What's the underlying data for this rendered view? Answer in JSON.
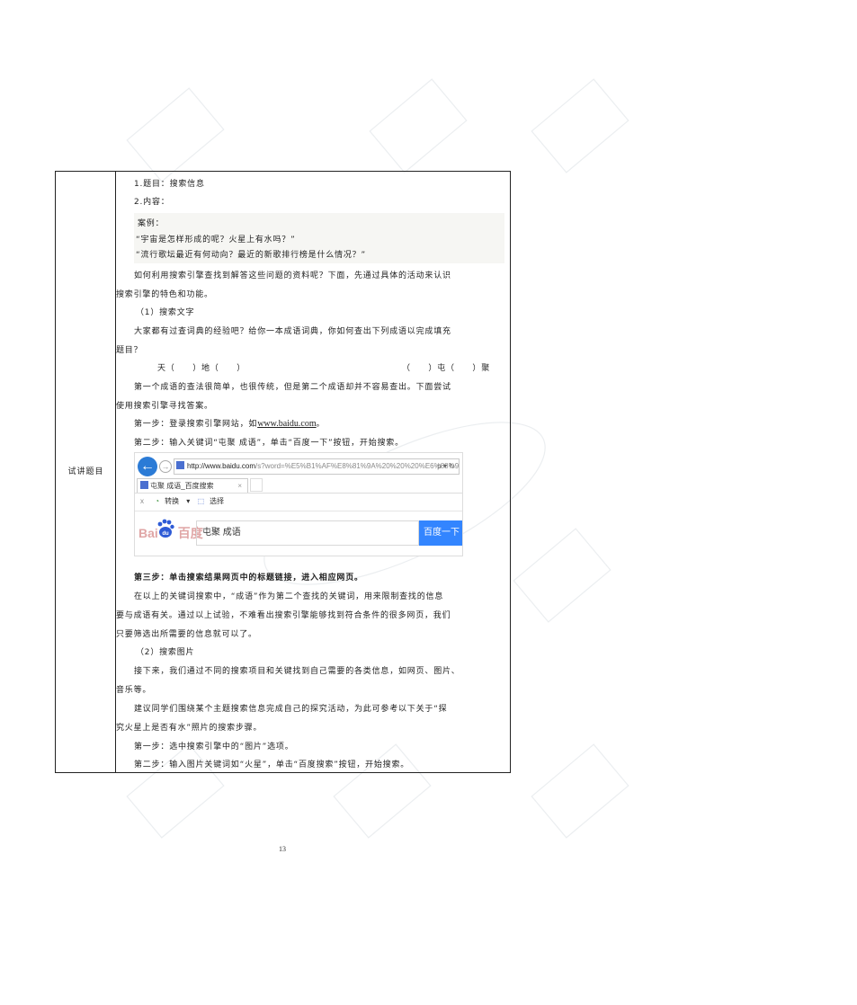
{
  "table": {
    "left_label": "试讲题目",
    "item1": "1.题目：搜索信息",
    "item2": "2.内容：",
    "case": {
      "title": "案例：",
      "q1": "“宇宙是怎样形成的呢？火星上有水吗？”",
      "q2": "“流行歌坛最近有何动向？最近的新歌排行榜是什么情况？”"
    },
    "para1_l1": "如何利用搜索引擎查找到解答这些问题的资料呢？下面，先通过具体的活动来认识",
    "para1_l2": "搜索引擎的特色和功能。",
    "section1": "（1）搜索文字",
    "para2_l1": "大家都有过查词典的经验吧？给你一本成语词典，你如何查出下列成语以完成填充",
    "para2_l2": "题目？",
    "fill_left": "天（　　）地（　　）",
    "fill_right": "（　　）屯（　　）聚",
    "para3_l1": "第一个成语的查法很简单，也很传统，但是第二个成语却并不容易查出。下面尝试",
    "para3_l2": "使用搜索引擎寻找答案。",
    "step1_prefix": "第一步：登录搜索引擎网站，如",
    "step1_link": "www.baidu.com",
    "step1_suffix": "。",
    "step2": "第二步：输入关键词“屯聚 成语”，单击“百度一下”按钮，开始搜索。",
    "step3": "第三步：单击搜索结果网页中的标题链接，进入相应网页。",
    "para4_l1": "在以上的关键词搜索中，“成语”作为第二个查找的关键词，用来限制查找的信息",
    "para4_l2": "要与成语有关。通过以上试验，不难看出搜索引擎能够找到符合条件的很多网页，我们",
    "para4_l3": "只要筛选出所需要的信息就可以了。",
    "section2": "（2）搜索图片",
    "para5_l1": "接下来，我们通过不同的搜索项目和关键找到自己需要的各类信息，如网页、图片、",
    "para5_l2": "音乐等。",
    "para6_l1": "建议同学们围绕某个主题搜索信息完成自己的探究活动，为此可参考以下关于“探",
    "para6_l2": "究火星上是否有水”照片的搜索步骤。",
    "img_step1": "第一步：选中搜索引擎中的“图片”选项。",
    "img_step2": "第二步：输入图片关键词如“火星”，单击“百度搜索”按钮，开始搜索。"
  },
  "browser": {
    "url_host": "http://www.baidu.com",
    "url_rest": "/s?word=%E5%B1%AF%E8%81%9A%20%20%20%E6%88%90%",
    "url_tools": "ρ ▾ ↻",
    "tab_title": "屯聚 成语_百度搜索",
    "tab_close": "×",
    "toolbar_close": "x",
    "toolbar_convert": "转换",
    "toolbar_select": "选择",
    "logo_left": "Bai",
    "logo_right": "百度",
    "search_query": "屯聚 成语",
    "search_button": "百度一下",
    "accent_color": "#3385ff"
  },
  "page_number": "13"
}
